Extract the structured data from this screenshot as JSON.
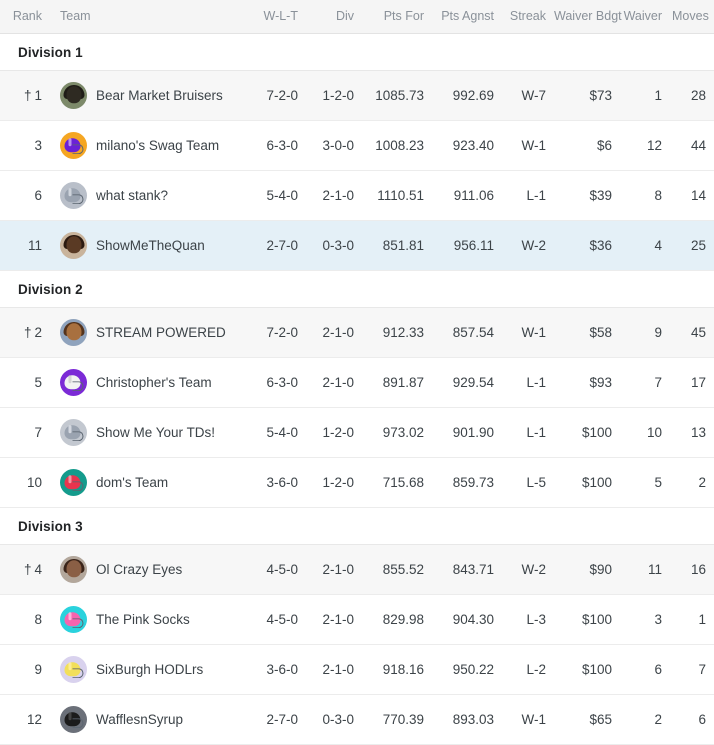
{
  "table": {
    "columns": [
      {
        "key": "rank",
        "label": "Rank"
      },
      {
        "key": "team",
        "label": "Team"
      },
      {
        "key": "wlt",
        "label": "W-L-T"
      },
      {
        "key": "div",
        "label": "Div"
      },
      {
        "key": "pf",
        "label": "Pts For"
      },
      {
        "key": "pa",
        "label": "Pts Agnst"
      },
      {
        "key": "streak",
        "label": "Streak"
      },
      {
        "key": "wbdgt",
        "label": "Waiver Bdgt"
      },
      {
        "key": "waiver",
        "label": "Waiver"
      },
      {
        "key": "moves",
        "label": "Moves"
      }
    ],
    "leader_marker": "†",
    "sections": [
      {
        "title": "Division 1",
        "rows": [
          {
            "leader": true,
            "active": false,
            "rank": "1",
            "team": "Bear Market Bruisers",
            "wlt": "7-2-0",
            "div": "1-2-0",
            "pf": "1085.73",
            "pa": "992.69",
            "streak": "W-7",
            "wbdgt": "$73",
            "waiver": "1",
            "moves": "28",
            "avatar": {
              "style": "photo",
              "bg": "#7d8a6a",
              "face": "#2e2a22",
              "hair": "#1f1c17"
            }
          },
          {
            "leader": false,
            "active": false,
            "rank": "3",
            "team": "milano's Swag Team",
            "wlt": "6-3-0",
            "div": "3-0-0",
            "pf": "1008.23",
            "pa": "923.40",
            "streak": "W-1",
            "wbdgt": "$6",
            "waiver": "12",
            "moves": "44",
            "avatar": {
              "style": "helmet",
              "bg": "#f5a623",
              "dome": "#6a21d6",
              "stripe": "#c9a6f2"
            }
          },
          {
            "leader": false,
            "active": false,
            "rank": "6",
            "team": "what stank?",
            "wlt": "5-4-0",
            "div": "2-1-0",
            "pf": "1110.51",
            "pa": "911.06",
            "streak": "L-1",
            "wbdgt": "$39",
            "waiver": "8",
            "moves": "14",
            "avatar": {
              "style": "helmet",
              "bg": "#b9bfc9",
              "dome": "#9aa3b0",
              "stripe": "#d8dde4"
            }
          },
          {
            "leader": false,
            "active": true,
            "rank": "11",
            "team": "ShowMeTheQuan",
            "wlt": "2-7-0",
            "div": "0-3-0",
            "pf": "851.81",
            "pa": "956.11",
            "streak": "W-2",
            "wbdgt": "$36",
            "waiver": "4",
            "moves": "25",
            "avatar": {
              "style": "photo",
              "bg": "#c9b49c",
              "face": "#5a3a24",
              "hair": "#2b1a10"
            }
          }
        ]
      },
      {
        "title": "Division 2",
        "rows": [
          {
            "leader": true,
            "active": false,
            "rank": "2",
            "team": "STREAM POWERED",
            "wlt": "7-2-0",
            "div": "2-1-0",
            "pf": "912.33",
            "pa": "857.54",
            "streak": "W-1",
            "wbdgt": "$58",
            "waiver": "9",
            "moves": "45",
            "avatar": {
              "style": "photo",
              "bg": "#8fa3bd",
              "face": "#a8703f",
              "hair": "#54331c"
            }
          },
          {
            "leader": false,
            "active": false,
            "rank": "5",
            "team": "Christopher's Team",
            "wlt": "6-3-0",
            "div": "2-1-0",
            "pf": "891.87",
            "pa": "929.54",
            "streak": "L-1",
            "wbdgt": "$93",
            "waiver": "7",
            "moves": "17",
            "avatar": {
              "style": "helmet",
              "bg": "#7b2ad6",
              "dome": "#f2f2f2",
              "stripe": "#cfcfcf"
            }
          },
          {
            "leader": false,
            "active": false,
            "rank": "7",
            "team": "Show Me Your TDs!",
            "wlt": "5-4-0",
            "div": "1-2-0",
            "pf": "973.02",
            "pa": "901.90",
            "streak": "L-1",
            "wbdgt": "$100",
            "waiver": "10",
            "moves": "13",
            "avatar": {
              "style": "helmet",
              "bg": "#c3c8d0",
              "dome": "#9aa3b0",
              "stripe": "#dde1e7"
            }
          },
          {
            "leader": false,
            "active": false,
            "rank": "10",
            "team": "dom's Team",
            "wlt": "3-6-0",
            "div": "1-2-0",
            "pf": "715.68",
            "pa": "859.73",
            "streak": "L-5",
            "wbdgt": "$100",
            "waiver": "5",
            "moves": "2",
            "avatar": {
              "style": "helmet",
              "bg": "#149b8c",
              "dome": "#e8344e",
              "stripe": "#f7a6b0"
            }
          }
        ]
      },
      {
        "title": "Division 3",
        "rows": [
          {
            "leader": true,
            "active": false,
            "rank": "4",
            "team": "Ol Crazy Eyes",
            "wlt": "4-5-0",
            "div": "2-1-0",
            "pf": "855.52",
            "pa": "843.71",
            "streak": "W-2",
            "wbdgt": "$90",
            "waiver": "11",
            "moves": "16",
            "avatar": {
              "style": "photo",
              "bg": "#b3a79b",
              "face": "#8a5f45",
              "hair": "#3a2419"
            }
          },
          {
            "leader": false,
            "active": false,
            "rank": "8",
            "team": "The Pink Socks",
            "wlt": "4-5-0",
            "div": "2-1-0",
            "pf": "829.98",
            "pa": "904.30",
            "streak": "L-3",
            "wbdgt": "$100",
            "waiver": "3",
            "moves": "1",
            "avatar": {
              "style": "helmet",
              "bg": "#2ad2dd",
              "dome": "#f764ae",
              "stripe": "#ffc2e0"
            }
          },
          {
            "leader": false,
            "active": false,
            "rank": "9",
            "team": "SixBurgh HODLrs",
            "wlt": "3-6-0",
            "div": "2-1-0",
            "pf": "918.16",
            "pa": "950.22",
            "streak": "L-2",
            "wbdgt": "$100",
            "waiver": "6",
            "moves": "7",
            "avatar": {
              "style": "helmet",
              "bg": "#d9d2ee",
              "dome": "#f2df5a",
              "stripe": "#fff0a0"
            }
          },
          {
            "leader": false,
            "active": false,
            "rank": "12",
            "team": "WafflesnSyrup",
            "wlt": "2-7-0",
            "div": "0-3-0",
            "pf": "770.39",
            "pa": "893.03",
            "streak": "W-1",
            "wbdgt": "$65",
            "waiver": "2",
            "moves": "6",
            "avatar": {
              "style": "helmet",
              "bg": "#6b7079",
              "dome": "#1b1b1b",
              "stripe": "#4a4a4a"
            }
          }
        ]
      }
    ]
  }
}
